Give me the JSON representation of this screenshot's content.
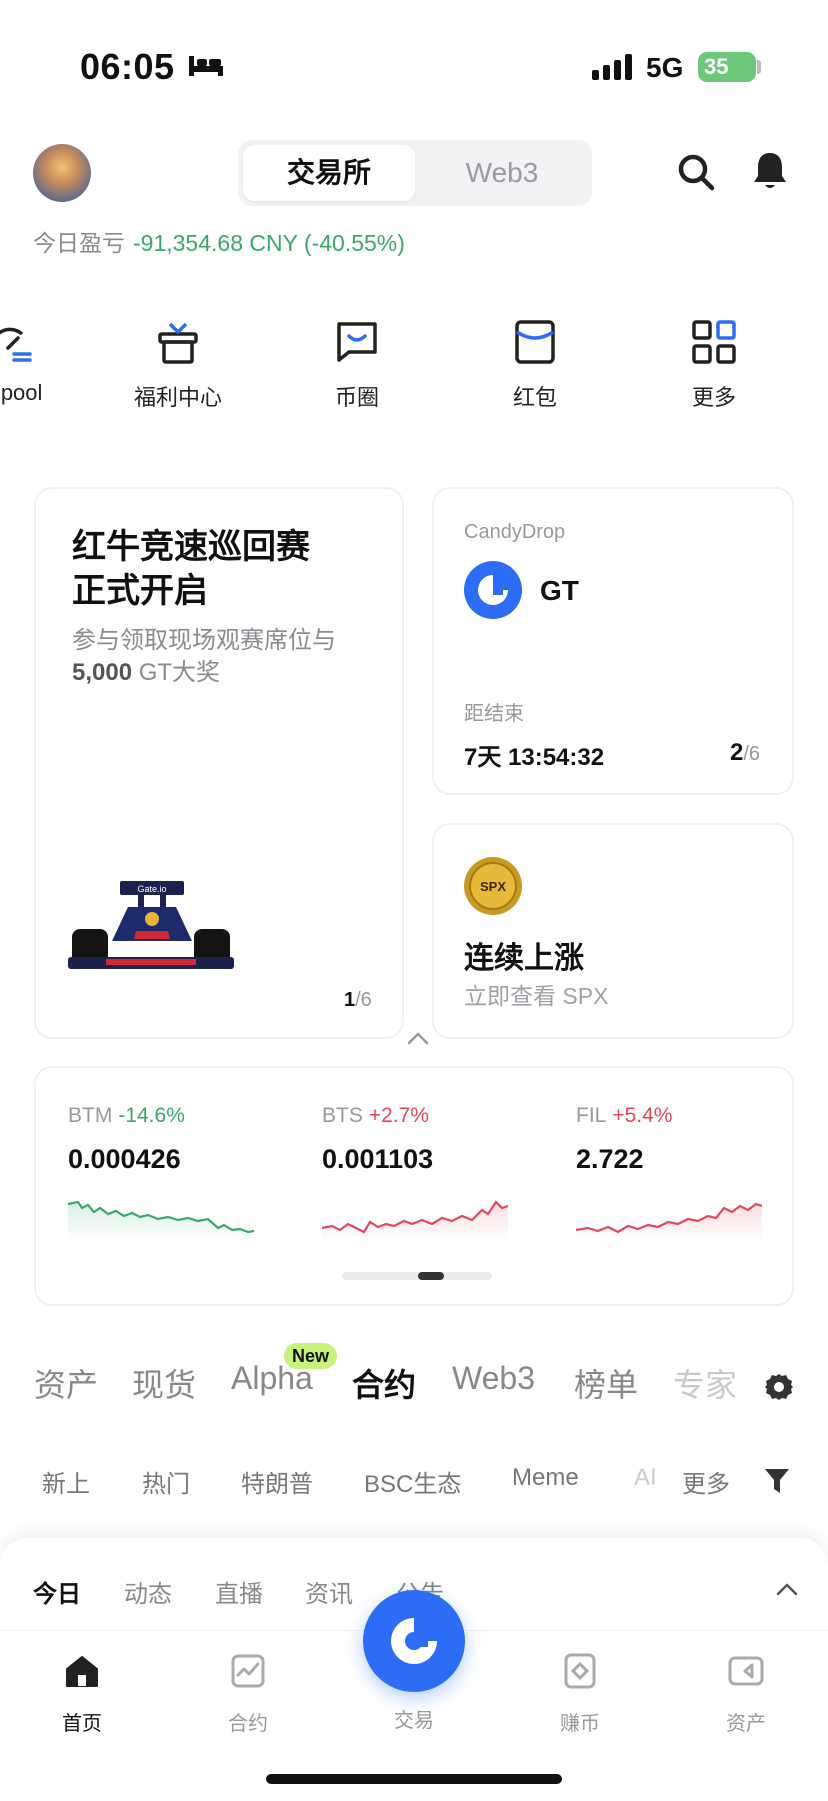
{
  "status_bar": {
    "time": "06:05",
    "network": "5G",
    "battery": "35",
    "icons": [
      "bed-icon",
      "signal-icon",
      "battery-icon"
    ]
  },
  "header": {
    "tabs": [
      "交易所",
      "Web3"
    ],
    "active_tab": "交易所",
    "pnl_label": "今日盈亏",
    "pnl_value": "-91,354.68 CNY (-40.55%)",
    "pnl_color": "#3aa86b"
  },
  "shortcuts": [
    {
      "label": "chpool",
      "icon": "launchpool-icon"
    },
    {
      "label": "福利中心",
      "icon": "gift-icon"
    },
    {
      "label": "币圈",
      "icon": "chat-icon"
    },
    {
      "label": "红包",
      "icon": "red-envelope-icon"
    },
    {
      "label": "更多",
      "icon": "grid-icon"
    }
  ],
  "promo_card": {
    "title": "红牛竞速巡回赛\n正式开启",
    "subtitle_prefix": "参与领取现场观赛席位与",
    "subtitle_bold": "5,000",
    "subtitle_suffix": " GT大奖",
    "page_current": "1",
    "page_total": "/6"
  },
  "candydrop_card": {
    "label": "CandyDrop",
    "token": "GT",
    "end_label": "距结束",
    "countdown": "7天 13:54:32",
    "page_current": "2",
    "page_total": "/6"
  },
  "spx_card": {
    "title": "连续上涨",
    "subtitle": "立即查看 SPX"
  },
  "tickers": [
    {
      "symbol": "BTM",
      "change": "-14.6%",
      "price": "0.000426",
      "direction": "down"
    },
    {
      "symbol": "BTS",
      "change": "+2.7%",
      "price": "0.001103",
      "direction": "up"
    },
    {
      "symbol": "FIL",
      "change": "+5.4%",
      "price": "2.722",
      "direction": "up"
    }
  ],
  "categories": {
    "items": [
      "资产",
      "现货",
      "Alpha",
      "合约",
      "Web3",
      "榜单",
      "专家"
    ],
    "active": "合约",
    "new_badge": "New"
  },
  "sub_tabs": [
    "新上",
    "热门",
    "特朗普",
    "BSC生态",
    "Meme",
    "AI",
    "更多"
  ],
  "news_tabs": {
    "items": [
      "今日",
      "动态",
      "直播",
      "资讯",
      "公告"
    ],
    "active": "今日"
  },
  "bottom_nav": [
    {
      "label": "首页",
      "icon": "home-icon",
      "active": true
    },
    {
      "label": "合约",
      "icon": "futures-icon",
      "active": false
    },
    {
      "label": "交易",
      "icon": "trade-icon",
      "active": false
    },
    {
      "label": "赚币",
      "icon": "earn-icon",
      "active": false
    },
    {
      "label": "资产",
      "icon": "wallet-icon",
      "active": false
    }
  ],
  "colors": {
    "accent": "#2d6df6",
    "up": "#e0485a",
    "down": "#3aa86b",
    "new_badge": "#c8f27a"
  }
}
